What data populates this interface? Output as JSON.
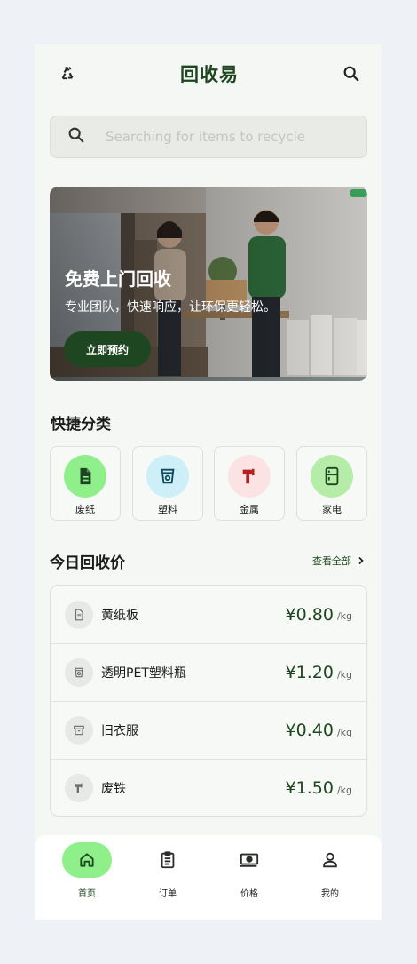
{
  "header": {
    "title": "回收易",
    "logo_icon": "recycle-icon",
    "search_icon": "search-icon"
  },
  "search": {
    "placeholder": "Searching for items to recycle"
  },
  "banner": {
    "title": "免费上门回收",
    "subtitle": "专业团队，快速响应，让环保更轻松。",
    "cta_label": "立即预约"
  },
  "categories": {
    "title": "快捷分类",
    "items": [
      {
        "label": "废纸",
        "icon": "document-icon",
        "bg": "#8ff08b",
        "fg": "#1e4620"
      },
      {
        "label": "塑料",
        "icon": "cup-icon",
        "bg": "#cdeff7",
        "fg": "#0f4a5a"
      },
      {
        "label": "金属",
        "icon": "hammer-icon",
        "bg": "#fbe3e3",
        "fg": "#b3201e"
      },
      {
        "label": "家电",
        "icon": "fridge-icon",
        "bg": "#b5eda8",
        "fg": "#1e4620"
      }
    ]
  },
  "prices": {
    "title": "今日回收价",
    "view_all": "查看全部",
    "items": [
      {
        "name": "黄纸板",
        "price": "¥0.80",
        "unit": "/kg",
        "icon": "document-icon"
      },
      {
        "name": "透明PET塑料瓶",
        "price": "¥1.20",
        "unit": "/kg",
        "icon": "cup-icon"
      },
      {
        "name": "旧衣服",
        "price": "¥0.40",
        "unit": "/kg",
        "icon": "box-icon"
      },
      {
        "name": "废铁",
        "price": "¥1.50",
        "unit": "/kg",
        "icon": "hammer-icon"
      }
    ]
  },
  "nav": {
    "items": [
      {
        "label": "首页",
        "icon": "home-icon",
        "active": true
      },
      {
        "label": "订单",
        "icon": "clipboard-icon",
        "active": false
      },
      {
        "label": "价格",
        "icon": "money-icon",
        "active": false
      },
      {
        "label": "我的",
        "icon": "person-icon",
        "active": false
      }
    ]
  },
  "colors": {
    "primary": "#1e4620",
    "accent_green": "#8ff08b",
    "background": "#f4f7f3"
  }
}
